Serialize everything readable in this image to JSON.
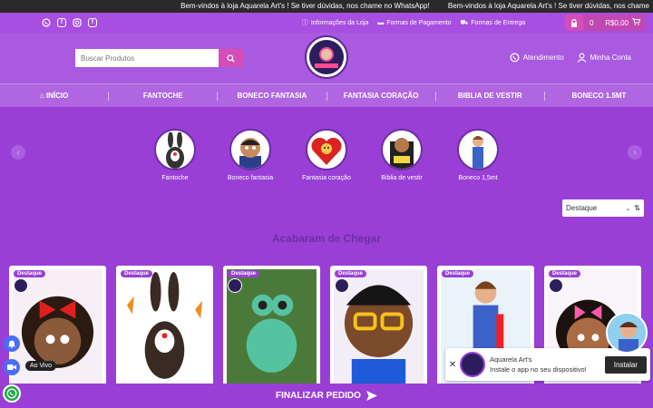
{
  "marquee": {
    "messages": [
      "Bem-vindos à loja Aquarela Art's ! Se tiver dúvidas, nos chame no WhatsApp!",
      "Bem-vindos à loja Aquarela Art's ! Se tiver dúvidas, nos chame"
    ]
  },
  "topbar": {
    "social_icons": [
      "whatsapp-icon",
      "facebook-icon",
      "instagram-icon",
      "facebook-square-icon"
    ],
    "links": [
      {
        "label": "Informações da Loja",
        "icon": "info-icon"
      },
      {
        "label": "Formas de Pagamento",
        "icon": "card-icon"
      },
      {
        "label": "Formas de Entrega",
        "icon": "truck-icon"
      }
    ],
    "cart": {
      "count": "0",
      "total": "R$0,00"
    }
  },
  "header": {
    "search_placeholder": "Buscar Produtos",
    "atendimento": "Atendimento",
    "minha_conta": "Minha Conta"
  },
  "nav": {
    "items": [
      "INÍCIO",
      "FANTOCHE",
      "BONECO FANTASIA",
      "FANTASIA CORAÇÃO",
      "BIBLIA DE VESTIR",
      "BONECO 1.5MT"
    ]
  },
  "categories": [
    {
      "label": "Fantoche"
    },
    {
      "label": "Boneco fantasia"
    },
    {
      "label": "Fantasia coração"
    },
    {
      "label": "Biblia de vestir"
    },
    {
      "label": "Boneco 1,5mt"
    }
  ],
  "sort": {
    "selected": "Destaque"
  },
  "section": {
    "title": "Acabaram de Chegar"
  },
  "products": [
    {
      "badge": "Destaque"
    },
    {
      "badge": "Destaque"
    },
    {
      "badge": "Destaque"
    },
    {
      "badge": "Destaque"
    },
    {
      "badge": "Destaque"
    },
    {
      "badge": "Destaque"
    }
  ],
  "live": {
    "label": "Ao Vivo"
  },
  "install": {
    "app_name": "Aquarela Art's",
    "message": "Instale o app no seu dispositivo!",
    "button": "Instalar"
  },
  "finalizar": {
    "label": "FINALIZAR PEDIDO"
  },
  "colors": {
    "brand": "#9a3fd6",
    "accent_pink": "#d64db8",
    "section_title": "#6b2fa6"
  }
}
